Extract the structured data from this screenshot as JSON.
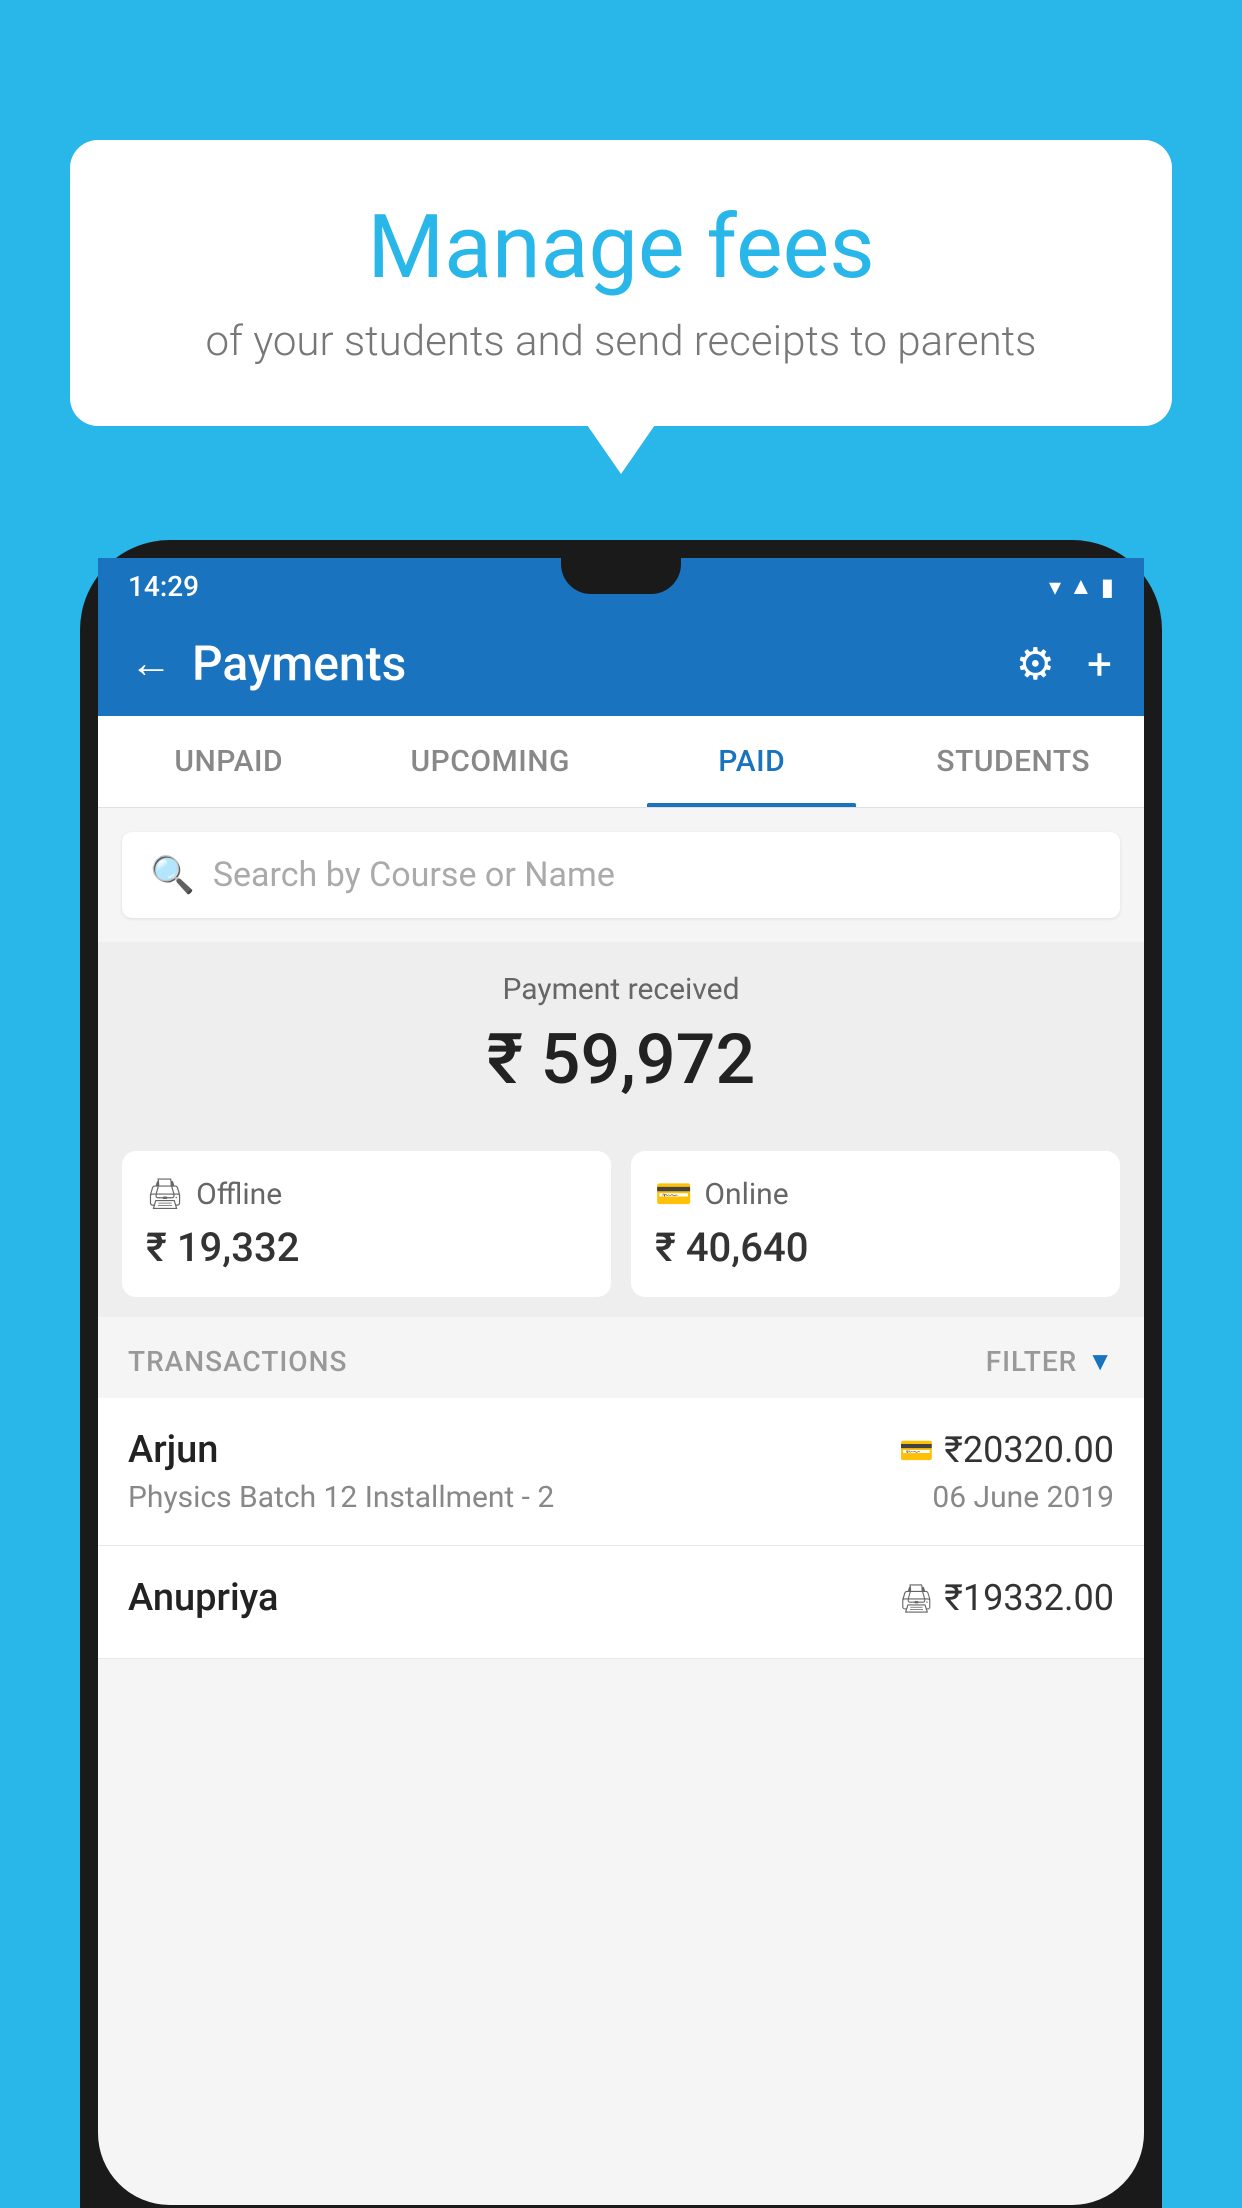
{
  "background_color": "#29b6e8",
  "bubble": {
    "title": "Manage fees",
    "subtitle": "of your students and send receipts to parents"
  },
  "phone": {
    "time": "14:29",
    "status_icons": [
      "wifi",
      "signal",
      "battery"
    ]
  },
  "header": {
    "title": "Payments",
    "back_label": "←",
    "settings_label": "⚙",
    "add_label": "+"
  },
  "tabs": [
    {
      "label": "UNPAID",
      "active": false
    },
    {
      "label": "UPCOMING",
      "active": false
    },
    {
      "label": "PAID",
      "active": true
    },
    {
      "label": "STUDENTS",
      "active": false
    }
  ],
  "search": {
    "placeholder": "Search by Course or Name"
  },
  "payment_summary": {
    "label": "Payment received",
    "amount": "₹ 59,972"
  },
  "payment_cards": [
    {
      "icon": "💳",
      "label": "Offline",
      "amount": "₹ 19,332"
    },
    {
      "icon": "💳",
      "label": "Online",
      "amount": "₹ 40,640"
    }
  ],
  "transactions_label": "TRANSACTIONS",
  "filter_label": "FILTER",
  "transactions": [
    {
      "name": "Arjun",
      "payment_type": "card",
      "amount": "₹20320.00",
      "course": "Physics Batch 12 Installment - 2",
      "date": "06 June 2019"
    },
    {
      "name": "Anupriya",
      "payment_type": "cash",
      "amount": "₹19332.00",
      "course": "",
      "date": ""
    }
  ]
}
